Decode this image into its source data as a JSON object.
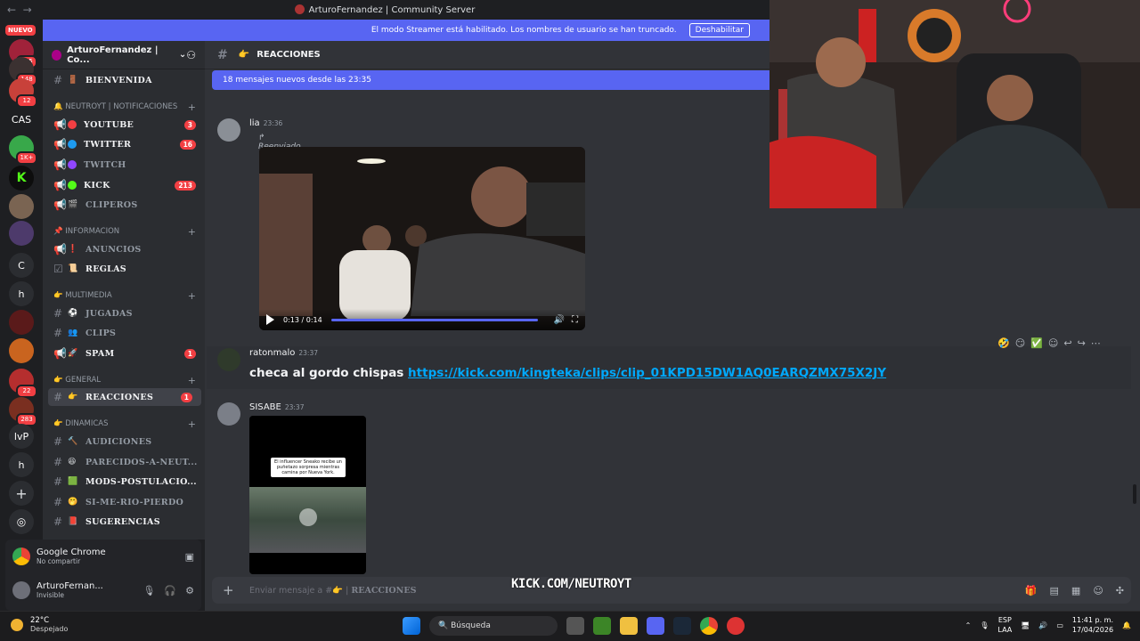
{
  "window": {
    "title": "ArturoFernandez | Community Server"
  },
  "rail": {
    "nuevo": "NUEVO",
    "servers": [
      {
        "label": "",
        "badge": "245"
      },
      {
        "label": "",
        "badge": "148"
      },
      {
        "label": "",
        "badge": "12"
      },
      {
        "label": "CAS",
        "badge": ""
      },
      {
        "label": "",
        "badge": "1K+"
      },
      {
        "label": "",
        "badge": ""
      },
      {
        "label": "",
        "badge": ""
      },
      {
        "label": "",
        "badge": ""
      },
      {
        "label": "C",
        "badge": ""
      },
      {
        "label": "h",
        "badge": ""
      },
      {
        "label": "",
        "badge": ""
      },
      {
        "label": "",
        "badge": ""
      },
      {
        "label": "",
        "badge": "22"
      },
      {
        "label": "",
        "badge": "283"
      },
      {
        "label": "lvP",
        "badge": ""
      },
      {
        "label": "h",
        "badge": ""
      }
    ]
  },
  "banner": {
    "text": "El modo Streamer está habilitado. Los nombres de usuario se han truncado.",
    "button": "Deshabilitar"
  },
  "guild": {
    "name": "ArturoFernandez | Co..."
  },
  "channels": {
    "bienvenida": "BIENVENIDA",
    "cat_notif": "NEUTROYT | NOTIFICACIONES",
    "youtube": "YOUTUBE",
    "youtube_count": "3",
    "twitter": "TWITTER",
    "twitter_count": "16",
    "twitch": "TWITCH",
    "kick": "KICK",
    "kick_count": "213",
    "clipero": "CLIPEROS",
    "cat_info": "INFORMACION",
    "anuncios": "ANUNCIOS",
    "reglas": "REGLAS",
    "cat_multi": "MULTIMEDIA",
    "jugadas": "JUGADAS",
    "clips": "CLIPS",
    "spam": "SPAM",
    "spam_count": "1",
    "cat_general": "GENERAL",
    "reacciones": "REACCIONES",
    "reacciones_count": "1",
    "cat_dinamicas": "DINAMICAS",
    "audiciones": "AUDICIONES",
    "parecidos": "PARECIDOS-A-NEUT...",
    "mods": "MODS-POSTULACIO...",
    "si_me_rio": "SI-ME-RIO-PIERDO",
    "sugerencias": "SUGERENCIAS"
  },
  "user_panel": {
    "app_name": "Google Chrome",
    "app_sub": "No compartir",
    "username": "ArturoFernan...",
    "status": "Invisible"
  },
  "chat": {
    "channel": "REACCIONES",
    "new_messages": "18 mensajes nuevos desde las 23:35",
    "msg1": {
      "author": "lia",
      "time": "23:36",
      "forwarded": "Reenviado",
      "video_time": "0:13 / 0:14"
    },
    "msg2": {
      "author": "ratonmalo",
      "time": "23:37",
      "text": "checa al gordo chispas",
      "link": "https://kick.com/kingteka/clips/clip_01KPD15DW1AQ0EARQZMX75X2JY"
    },
    "msg3": {
      "author": "SISABE",
      "time": "23:37",
      "thumb_caption": "El influencer Sneako recibe un puñetazo sorpresa mientras camina por Nueva York."
    },
    "composer_placeholder": "Enviar mensaje a #",
    "composer_channel": "REACCIONES"
  },
  "overlay": {
    "kick": "KICK.COM/NEUTROYT"
  },
  "taskbar": {
    "temp": "22°C",
    "weather": "Despejado",
    "search": "Búsqueda",
    "lang1": "ESP",
    "lang2": "LAA",
    "time": "11:41 p. m.",
    "date": "17/04/2026"
  },
  "colors": {
    "accent": "#5865f2",
    "danger": "#f23f43",
    "link": "#00a8fc",
    "kick": "#53fc18"
  }
}
